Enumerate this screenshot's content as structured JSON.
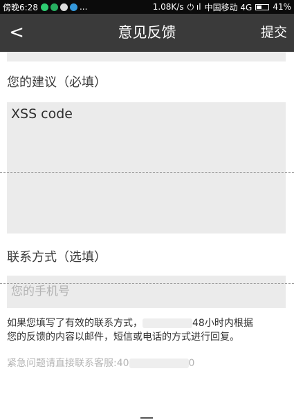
{
  "status_bar": {
    "time": "傍晚6:28",
    "more": "...",
    "speed": "1.08K/s",
    "signal": "⏻ ıl",
    "carrier": "中国移动 4G",
    "battery": "41%",
    "battery_level": 0.41
  },
  "nav": {
    "back_icon": "chevron-left-icon",
    "back_glyph": "<",
    "title": "意见反馈",
    "submit_label": "提交"
  },
  "form": {
    "suggestion_label": "您的建议（必填）",
    "suggestion_value": "XSS code",
    "contact_label": "联系方式（选填）",
    "phone_placeholder": "您的手机号",
    "notice_line1_a": "如果您填写了有效的联系方式，",
    "notice_line1_b": "48小时内根据",
    "notice_line2": "您的反馈的内容以邮件，短信或电话的方式进行回复。",
    "hotline_prefix": "紧急问题请直接联系客服:40",
    "hotline_suffix": "0"
  },
  "colors": {
    "status_bar_bg": "#0b0b0b",
    "nav_bg": "#3a3a3a",
    "input_bg": "#ebebeb",
    "hint_text": "#b4b4b4"
  }
}
